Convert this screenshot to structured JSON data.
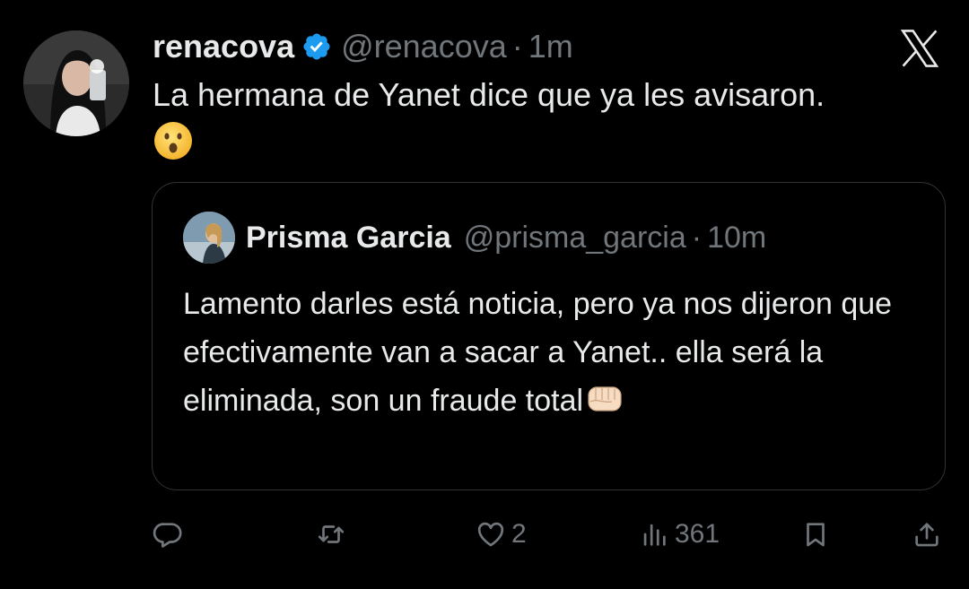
{
  "author": {
    "name": "renacova",
    "handle": "@renacova",
    "separator": "·",
    "time": "1m",
    "verified": true
  },
  "tweet_text": "La hermana de Yanet dice que ya les avisaron.",
  "tweet_emoji": "hushed-face-emoji",
  "quoted": {
    "name": "Prisma Garcia",
    "handle": "@prisma_garcia",
    "separator": "·",
    "time": "10m",
    "text": "Lamento darles está noticia, pero ya nos dijeron que efectivamente van a sacar a Yanet.. ella será la eliminada, son un fraude total",
    "emoji": "oncoming-fist-emoji"
  },
  "actions": {
    "reply": {
      "icon": "reply-icon",
      "count": ""
    },
    "retweet": {
      "icon": "retweet-icon",
      "count": ""
    },
    "like": {
      "icon": "heart-icon",
      "count": "2"
    },
    "views": {
      "icon": "views-icon",
      "count": "361"
    },
    "bookmark": {
      "icon": "bookmark-icon",
      "count": ""
    },
    "share": {
      "icon": "share-icon",
      "count": ""
    }
  },
  "colors": {
    "background": "#000000",
    "text": "#e7e9ea",
    "muted": "#71767b",
    "border": "#2f3336",
    "verified": "#1d9bf0"
  }
}
